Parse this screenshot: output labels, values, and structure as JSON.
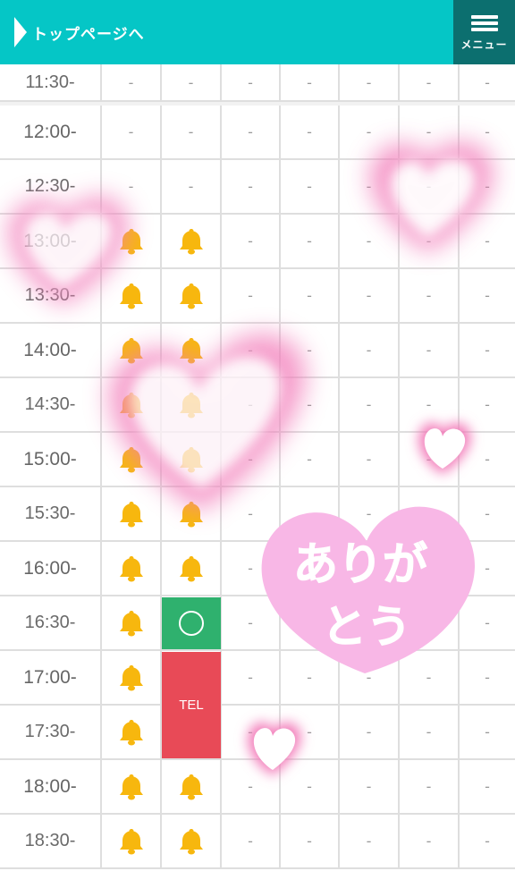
{
  "header": {
    "back_label": "トップページへ",
    "menu_label": "メニュー",
    "bg_color": "#05c6c6",
    "menu_bg_color": "#0c6f6f"
  },
  "schedule": {
    "empty_mark": "-",
    "rows": [
      {
        "time": "11:30-",
        "cells": [
          "dash",
          "dash",
          "dash",
          "dash",
          "dash",
          "dash",
          "dash"
        ]
      },
      {
        "time": "12:00-",
        "cells": [
          "dash",
          "dash",
          "dash",
          "dash",
          "dash",
          "dash",
          "dash"
        ]
      },
      {
        "time": "12:30-",
        "cells": [
          "dash",
          "dash",
          "dash",
          "dash",
          "dash",
          "dash",
          "dash"
        ]
      },
      {
        "time": "13:00-",
        "cells": [
          "bell",
          "bell",
          "dash",
          "dash",
          "dash",
          "dash",
          "dash"
        ]
      },
      {
        "time": "13:30-",
        "cells": [
          "bell",
          "bell",
          "dash",
          "dash",
          "dash",
          "dash",
          "dash"
        ]
      },
      {
        "time": "14:00-",
        "cells": [
          "bell",
          "bell",
          "dash",
          "dash",
          "dash",
          "dash",
          "dash"
        ]
      },
      {
        "time": "14:30-",
        "cells": [
          "bell",
          "bell",
          "dash",
          "dash",
          "dash",
          "dash",
          "dash"
        ]
      },
      {
        "time": "15:00-",
        "cells": [
          "bell",
          "bell",
          "dash",
          "dash",
          "dash",
          "dash",
          "dash"
        ]
      },
      {
        "time": "15:30-",
        "cells": [
          "bell",
          "bell",
          "dash",
          "dash",
          "dash",
          "dash",
          "dash"
        ]
      },
      {
        "time": "16:00-",
        "cells": [
          "bell",
          "bell",
          "dash",
          "dash",
          "dash",
          "dash",
          "dash"
        ]
      },
      {
        "time": "16:30-",
        "cells": [
          "bell",
          "ok",
          "dash",
          "dash",
          "dash",
          "dash",
          "dash"
        ]
      },
      {
        "time": "17:00-",
        "cells": [
          "bell",
          "tel",
          "dash",
          "dash",
          "dash",
          "dash",
          "dash"
        ]
      },
      {
        "time": "17:30-",
        "cells": [
          "bell",
          "tel",
          "dash",
          "dash",
          "dash",
          "dash",
          "dash"
        ]
      },
      {
        "time": "18:00-",
        "cells": [
          "bell",
          "bell",
          "dash",
          "dash",
          "dash",
          "dash",
          "dash"
        ]
      },
      {
        "time": "18:30-",
        "cells": [
          "bell",
          "bell",
          "dash",
          "dash",
          "dash",
          "dash",
          "dash"
        ]
      }
    ],
    "ok_icon": "circle-icon",
    "bell_icon": "bell-icon",
    "tel_label": "TEL",
    "ok_color": "#2fb16e",
    "tel_color": "#e84a57",
    "bell_color": "#f7b70e"
  },
  "overlay": {
    "thanks_text_line1": "ありが",
    "thanks_text_line2": "とう",
    "heart_color": "#f8b7e6",
    "glow_color": "#f279b8"
  }
}
